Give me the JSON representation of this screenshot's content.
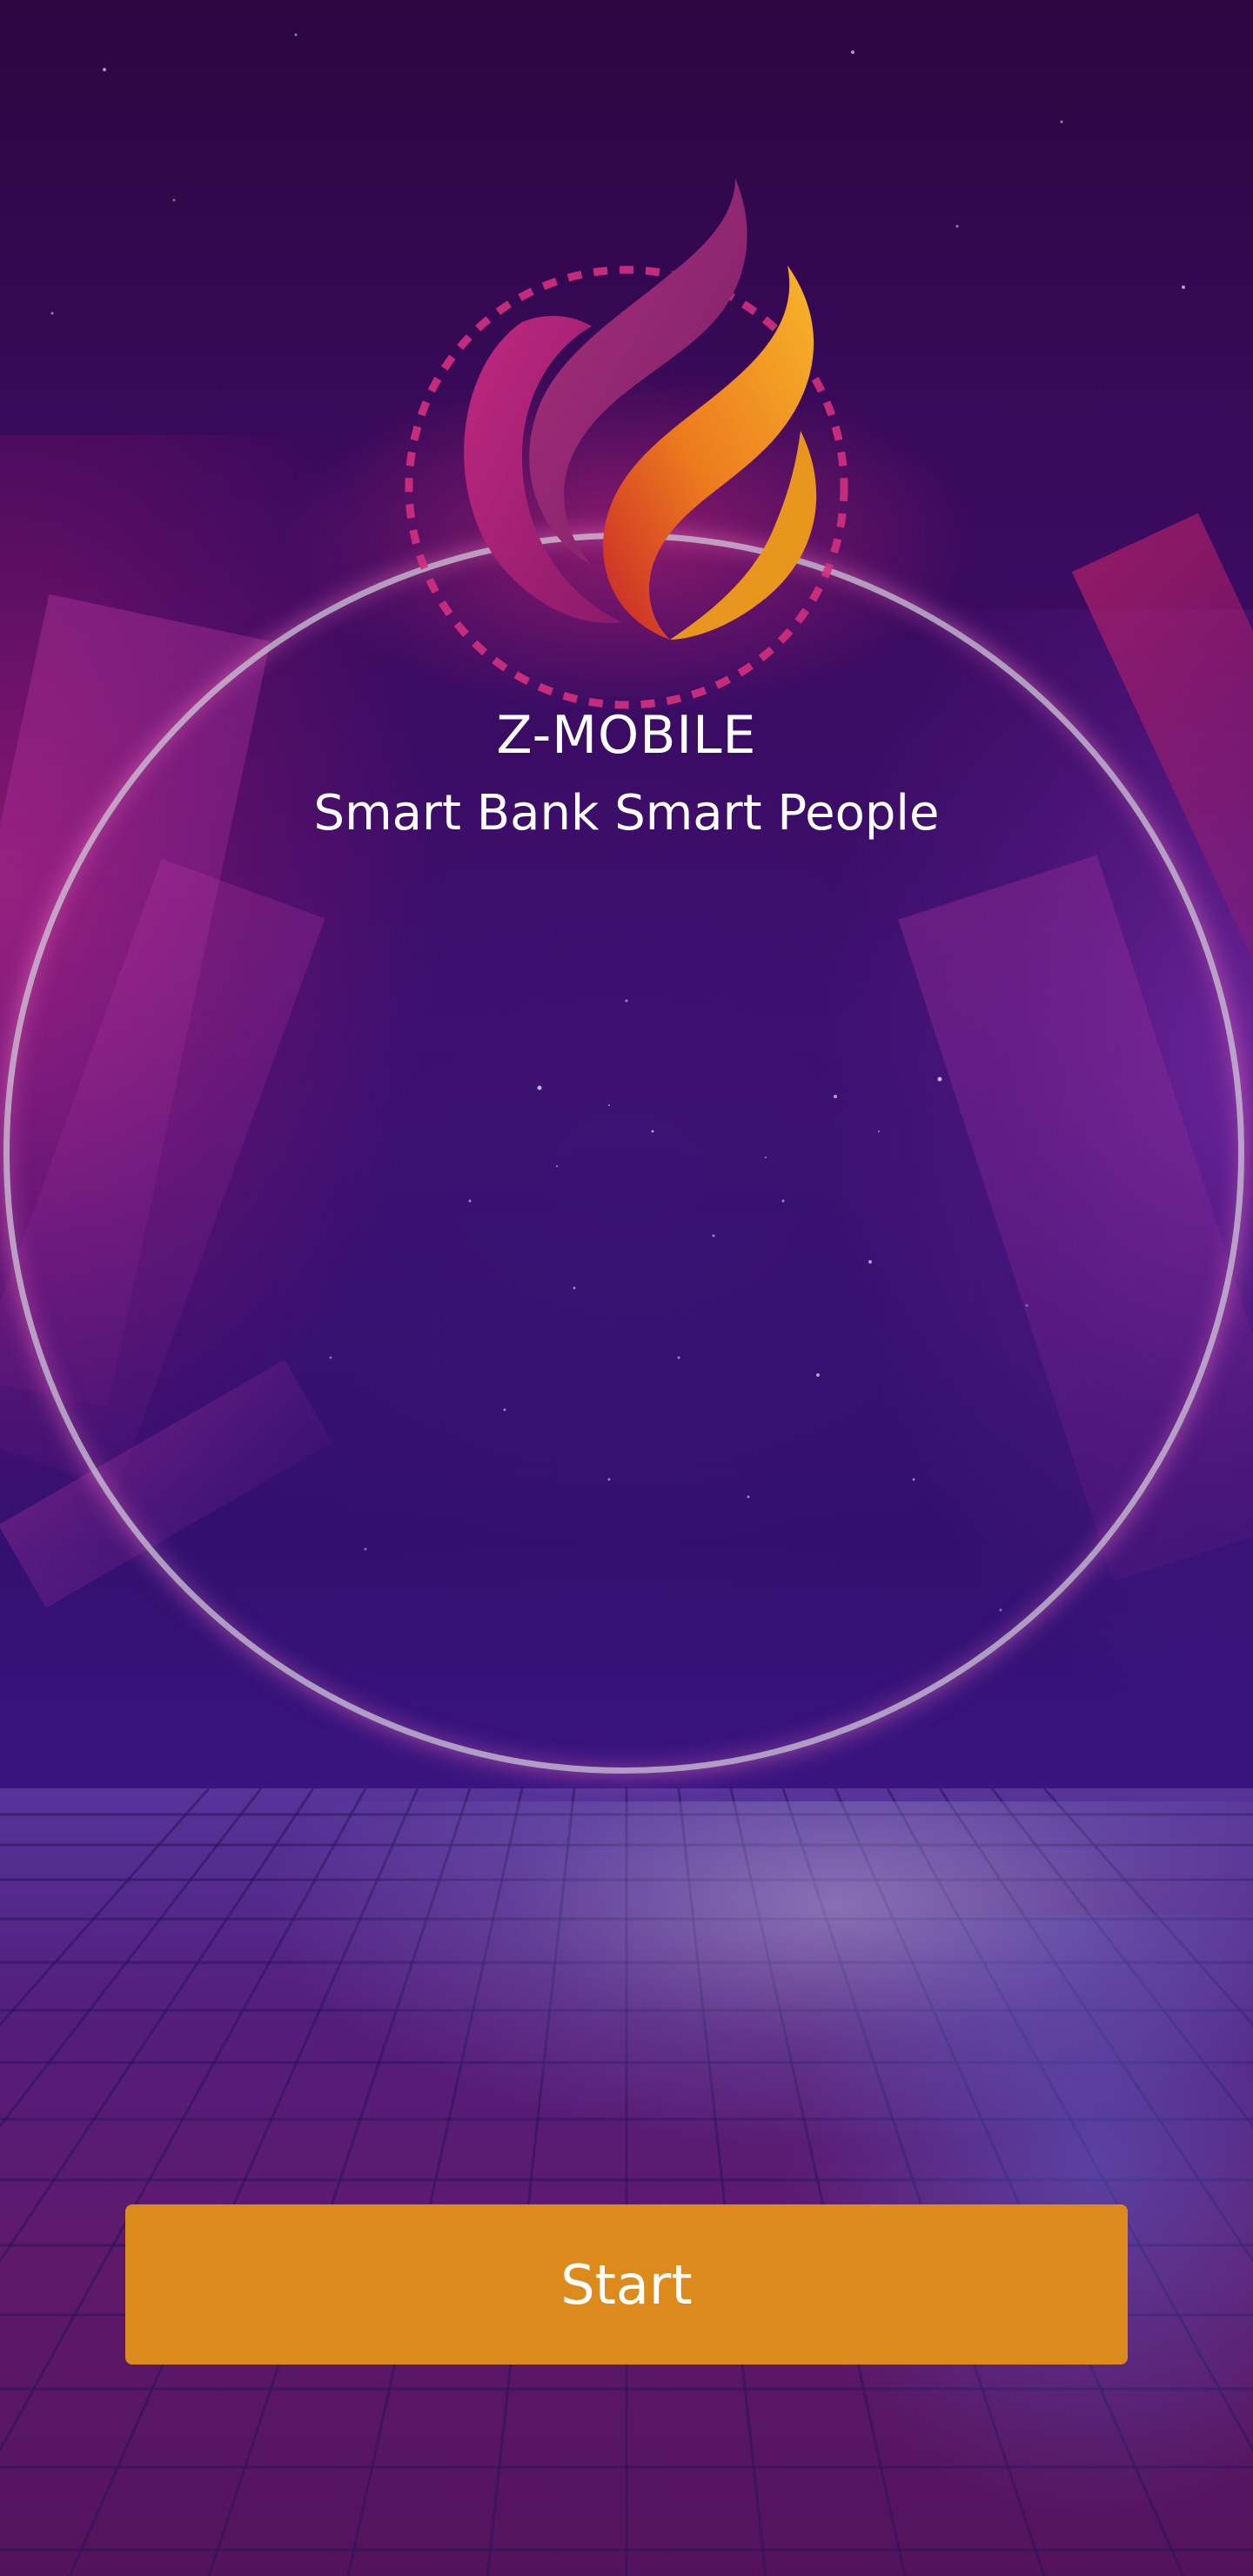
{
  "app": {
    "title": "Z-MOBILE",
    "tagline": "Smart Bank Smart People"
  },
  "actions": {
    "start_label": "Start"
  },
  "colors": {
    "button": "#dc8a1c",
    "flame_magenta": "#b0237a",
    "flame_orange": "#f0a020",
    "ring": "#dcd2e1"
  },
  "icons": {
    "logo": "flame-logo-icon"
  }
}
